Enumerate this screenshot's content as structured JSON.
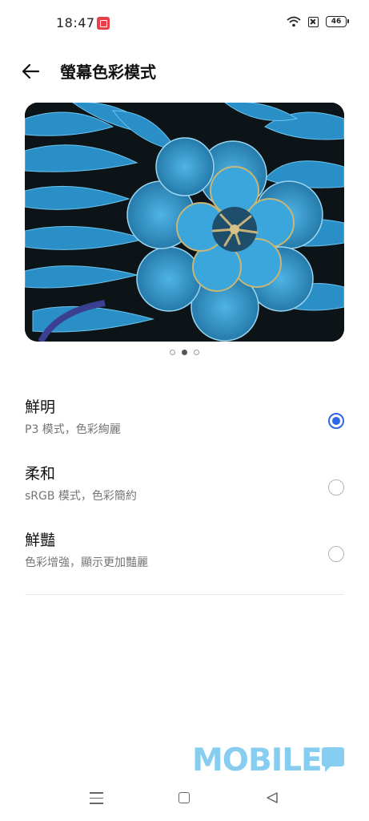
{
  "status_bar": {
    "time": "18:47",
    "battery": "46"
  },
  "header": {
    "title": "螢幕色彩模式"
  },
  "preview": {
    "page_count": 3,
    "active_index": 1
  },
  "options": [
    {
      "title": "鮮明",
      "subtitle": "P3 模式，色彩絢麗",
      "selected": true
    },
    {
      "title": "柔和",
      "subtitle": "sRGB 模式，色彩簡約",
      "selected": false
    },
    {
      "title": "鮮豔",
      "subtitle": "色彩增強，顯示更加豔麗",
      "selected": false
    }
  ],
  "watermark": {
    "text": "MOBILE"
  },
  "colors": {
    "accent": "#2d67e8",
    "watermark": "#86cdf0"
  }
}
